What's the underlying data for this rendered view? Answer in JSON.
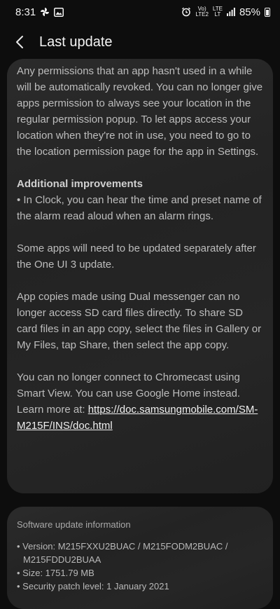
{
  "status_bar": {
    "time": "8:31",
    "volte_top": "Vo)",
    "volte_bottom": "LTE2",
    "lte_top": "LTE",
    "lte_bottom": "LT",
    "battery": "85%"
  },
  "header": {
    "title": "Last update"
  },
  "notes": {
    "p1": "Any permissions that an app hasn't used in a while will be automatically revoked. You can no longer give apps permission to always see your location in the regular permission popup. To let apps access your location when they're not in use, you need to go to the location permission page for the app in Settings.",
    "heading_additional": "Additional improvements",
    "p2": "• In Clock, you can hear the time and preset name of the alarm read aloud when an alarm rings.",
    "p3": "Some apps will need to be updated separately after the One UI 3 update.",
    "p4": "App copies made using Dual messenger can no longer access SD card files directly. To share SD card files in an app copy, select the files in Gallery or My Files, tap Share, then select the app copy.",
    "p5_text": "You can no longer connect to Chromecast using Smart View. You can use Google Home instead. Learn more at: ",
    "p5_link": "https://doc.samsungmobile.com/SM-M215F/INS/doc.html"
  },
  "software_info": {
    "title": "Software update information",
    "version_line1": "• Version: M215FXXU2BUAC / M215FODM2BUAC /",
    "version_line2": "M215FDDU2BUAA",
    "size": "• Size: 1751.79 MB",
    "security_patch": "• Security patch level: 1 January 2021"
  }
}
